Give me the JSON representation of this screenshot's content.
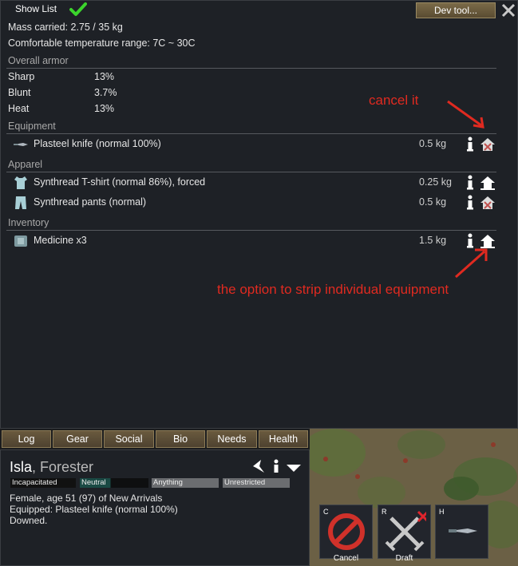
{
  "topbar": {
    "show_list": "Show List",
    "dev_tool": "Dev tool..."
  },
  "stats": {
    "mass": "Mass carried: 2.75 / 35 kg",
    "comfort": "Comfortable temperature range: 7C ~ 30C"
  },
  "armor": {
    "title": "Overall armor",
    "rows": [
      {
        "label": "Sharp",
        "value": "13%"
      },
      {
        "label": "Blunt",
        "value": "3.7%"
      },
      {
        "label": "Heat",
        "value": "13%"
      }
    ]
  },
  "equipment": {
    "title": "Equipment",
    "items": [
      {
        "name": "Plasteel knife (normal 100%)",
        "mass": "0.5 kg",
        "action": "cancel"
      }
    ]
  },
  "apparel": {
    "title": "Apparel",
    "items": [
      {
        "name": "Synthread T-shirt (normal 86%), forced",
        "mass": "0.25 kg",
        "action": "strip"
      },
      {
        "name": "Synthread pants (normal)",
        "mass": "0.5 kg",
        "action": "cancel"
      }
    ]
  },
  "inventory": {
    "title": "Inventory",
    "items": [
      {
        "name": "Medicine x3",
        "mass": "1.5 kg",
        "action": "strip"
      }
    ]
  },
  "annotations": {
    "cancel": "cancel it",
    "strip": "the option to strip individual equipment",
    "color": "#e02a20"
  },
  "tabs": [
    "Log",
    "Gear",
    "Social",
    "Bio",
    "Needs",
    "Health"
  ],
  "pawn": {
    "name": "Isla",
    "job": "Forester",
    "badges": [
      "Incapacitated",
      "Neutral",
      "Anything",
      "Unrestricted"
    ],
    "line1": "Female, age 51 (97) of New Arrivals",
    "line2": "Equipped: Plasteel knife (normal 100%)",
    "line3": "Downed."
  },
  "commands": [
    {
      "key": "C",
      "label": "Cancel",
      "icon": "cancel-icon"
    },
    {
      "key": "R",
      "label": "Draft",
      "icon": "draft-swords-icon"
    },
    {
      "key": "H",
      "label": "",
      "icon": "knife-icon"
    }
  ],
  "icons": [
    "check-icon",
    "close-icon",
    "info-icon",
    "strip-icon",
    "cancel-strip-icon",
    "knife-icon",
    "tshirt-icon",
    "pants-icon",
    "medicine-icon"
  ]
}
